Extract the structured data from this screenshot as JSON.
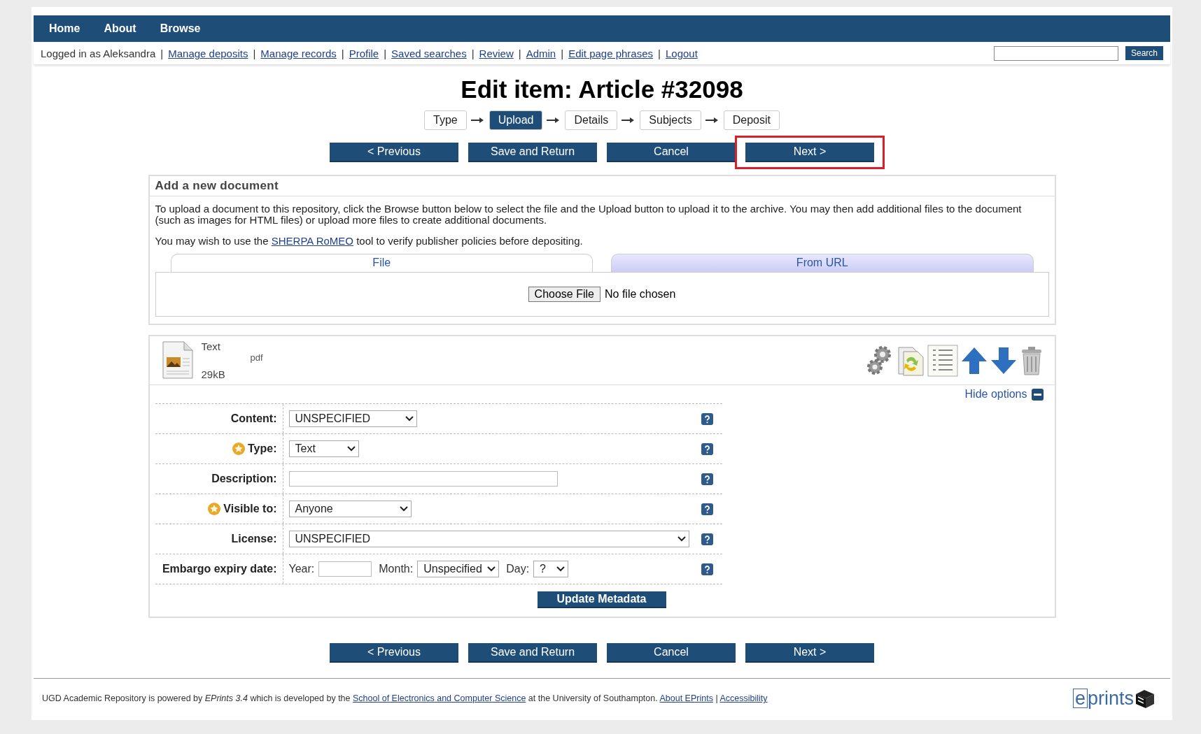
{
  "nav": [
    {
      "label": "Home"
    },
    {
      "label": "About"
    },
    {
      "label": "Browse"
    }
  ],
  "user_bar": {
    "logged_in": "Logged in as Aleksandra",
    "links": [
      {
        "label": "Manage deposits"
      },
      {
        "label": "Manage records"
      },
      {
        "label": "Profile"
      },
      {
        "label": "Saved searches"
      },
      {
        "label": "Review"
      },
      {
        "label": "Admin"
      },
      {
        "label": "Edit page phrases"
      },
      {
        "label": "Logout"
      }
    ],
    "separator": "|",
    "search_button": "Search"
  },
  "title": "Edit item: Article #32098",
  "steps": [
    {
      "label": "Type",
      "selected": false
    },
    {
      "label": "Upload",
      "selected": true
    },
    {
      "label": "Details",
      "selected": false
    },
    {
      "label": "Subjects",
      "selected": false
    },
    {
      "label": "Deposit",
      "selected": false
    }
  ],
  "top_buttons": [
    {
      "label": "< Previous",
      "highlighted": false
    },
    {
      "label": "Save and Return",
      "highlighted": false
    },
    {
      "label": "Cancel",
      "highlighted": false
    },
    {
      "label": "Next >",
      "highlighted": true
    }
  ],
  "new_document": {
    "heading": "Add a new document",
    "intro": "To upload a document to this repository, click the Browse button below to select the file and the Upload button to upload it to the archive. You may then add additional files to the document (such as images for HTML files) or upload more files to create additional documents.",
    "sherpa_before": "You may wish to use the",
    "sherpa_link": "SHERPA RoMEO",
    "sherpa_after": "tool to verify publisher policies before depositing.",
    "tabs": [
      {
        "label": "File",
        "selected": true
      },
      {
        "label": "From URL",
        "selected": false
      }
    ],
    "file_button": "Choose File",
    "file_status": "No file chosen"
  },
  "document": {
    "type": "Text",
    "format": "pdf",
    "size": "29kB",
    "hide_options": "Hide options",
    "fields": [
      {
        "label": "Content:",
        "kind": "select",
        "value": "UNSPECIFIED",
        "required": false
      },
      {
        "label": "Type:",
        "kind": "select",
        "value": "Text",
        "required": true
      },
      {
        "label": "Description:",
        "kind": "text",
        "required": false
      },
      {
        "label": "Visible to:",
        "kind": "select",
        "value": "Anyone",
        "required": true
      },
      {
        "label": "License:",
        "kind": "select",
        "value": "UNSPECIFIED",
        "required": false
      },
      {
        "label": "Embargo expiry date:",
        "kind": "date",
        "year_label": "Year:",
        "month_label": "Month:",
        "month_value": "Unspecified",
        "day_label": "Day:",
        "day_value": "?",
        "required": false
      }
    ],
    "update_button": "Update Metadata"
  },
  "bottom_buttons": [
    {
      "label": "< Previous",
      "highlighted": false
    },
    {
      "label": "Save and Return",
      "highlighted": false
    },
    {
      "label": "Cancel",
      "highlighted": false
    },
    {
      "label": "Next >",
      "highlighted": false
    }
  ],
  "footer": {
    "parts": [
      {
        "kind": "plain",
        "text": "UGD Academic Repository is powered by"
      },
      {
        "kind": "italic",
        "text": "EPrints 3.4"
      },
      {
        "kind": "plain",
        "text": "which is developed by the"
      },
      {
        "kind": "link",
        "text": "School of Electronics and Computer Science"
      },
      {
        "kind": "plain",
        "text": "at the University of Southampton."
      },
      {
        "kind": "link",
        "text": "About EPrints"
      },
      {
        "kind": "plain",
        "text": "|"
      },
      {
        "kind": "link",
        "text": "Accessibility"
      }
    ],
    "logo_letter": "e",
    "logo_rest": "prints"
  }
}
